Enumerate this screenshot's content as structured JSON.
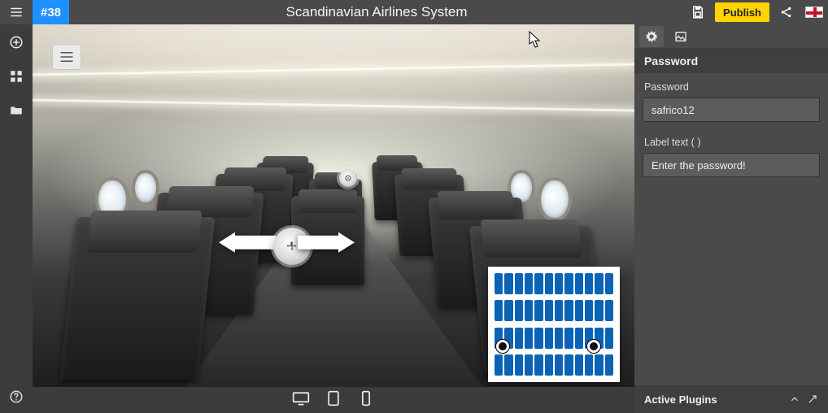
{
  "topbar": {
    "project_id": "#38",
    "title": "Scandinavian Airlines System",
    "publish_label": "Publish"
  },
  "right_panel": {
    "section_title": "Password",
    "password_label": "Password",
    "password_value": "safrico12",
    "label_text_label": "Label text ( )",
    "label_text_required_mark": "·",
    "label_text_value": "Enter the password!",
    "plugins_title": "Active Plugins"
  }
}
